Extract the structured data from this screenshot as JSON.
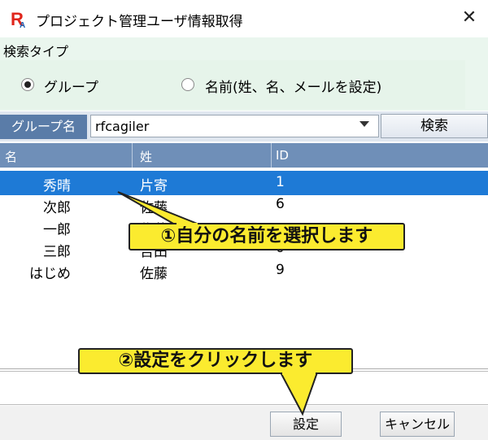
{
  "window": {
    "title": "プロジェクト管理ユーザ情報取得",
    "close_glyph": "✕",
    "app_icon": "RA"
  },
  "search_type": {
    "label": "検索タイプ",
    "options": [
      {
        "label": "グループ",
        "selected": true
      },
      {
        "label": "名前(姓、名、メールを設定)",
        "selected": false
      }
    ]
  },
  "group": {
    "label": "グループ名",
    "selected_value": "rfcagiler",
    "search_button": "検索"
  },
  "table": {
    "columns": [
      "名",
      "姓",
      "ID"
    ],
    "rows": [
      {
        "first": "秀晴",
        "last": "片寄",
        "id": "1",
        "selected": true
      },
      {
        "first": "次郎",
        "last": "佐藤",
        "id": "6",
        "selected": false
      },
      {
        "first": "一郎",
        "last": "佐藤",
        "id": "",
        "selected": false
      },
      {
        "first": "三郎",
        "last": "吉田",
        "id": "0",
        "selected": false
      },
      {
        "first": "はじめ",
        "last": "佐藤",
        "id": "9",
        "selected": false
      }
    ]
  },
  "buttons": {
    "set": "設定",
    "cancel": "キャンセル"
  },
  "callouts": {
    "step1": "①自分の名前を選択します",
    "step2": "②設定をクリックします"
  },
  "colors": {
    "selection": "#1e7ad6",
    "header": "#6f8fb8",
    "callout": "#fbeb2f"
  }
}
